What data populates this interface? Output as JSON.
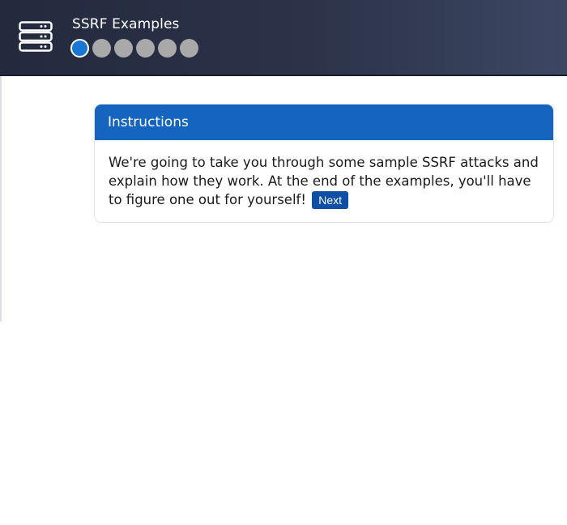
{
  "header": {
    "title": "SSRF Examples",
    "icon": "server-stack-icon",
    "steps": [
      {
        "state": "active"
      },
      {
        "state": "inactive"
      },
      {
        "state": "inactive"
      },
      {
        "state": "inactive"
      },
      {
        "state": "inactive"
      },
      {
        "state": "inactive"
      }
    ]
  },
  "instructions": {
    "title": "Instructions",
    "body": "We're going to take you through some sample SSRF attacks and explain how they work. At the end of the examples, you'll have to figure one out for yourself!",
    "next_label": "Next"
  },
  "colors": {
    "header_bg": "#2c3349",
    "card_header": "#1565c0",
    "button": "#0d4fa5",
    "step_active": "#1976d2",
    "step_inactive": "#a9a9a9"
  }
}
